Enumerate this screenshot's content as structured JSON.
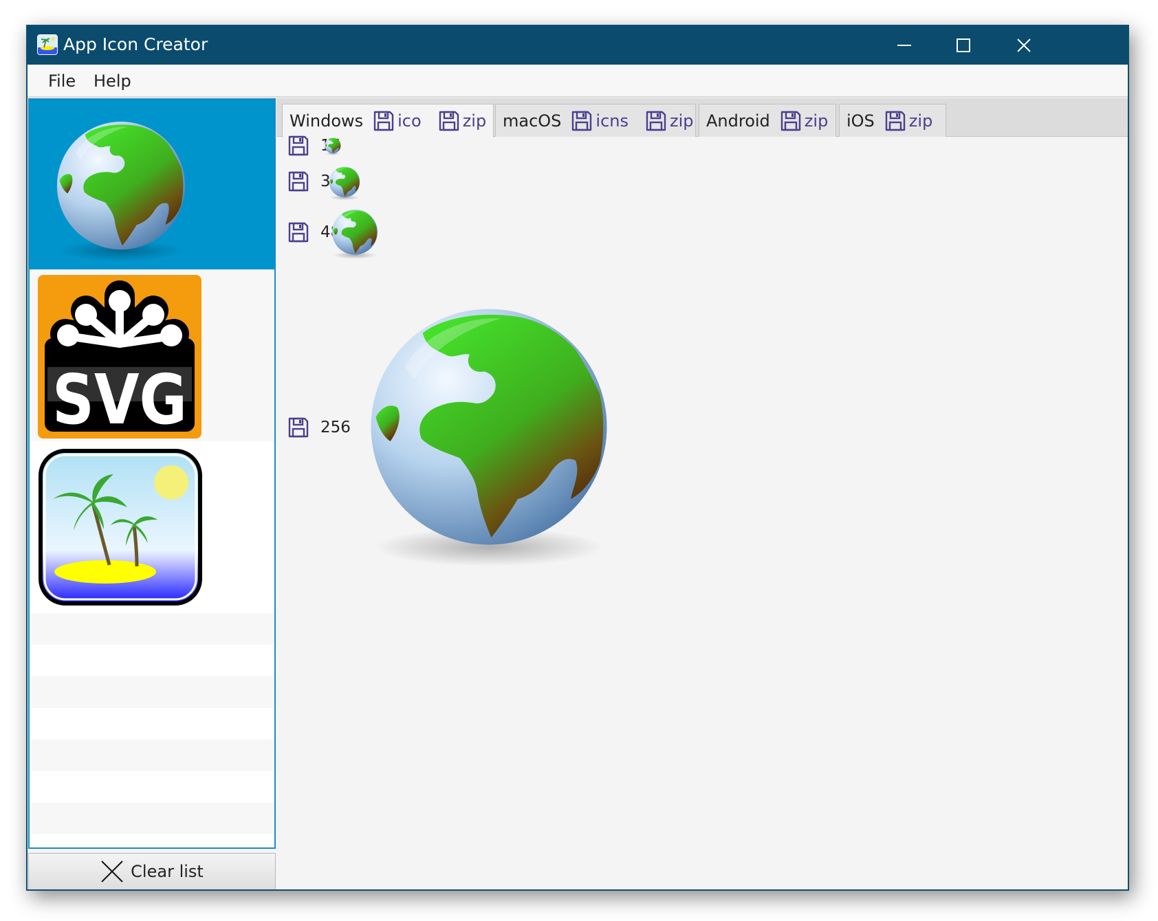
{
  "window": {
    "title": "App Icon Creator"
  },
  "menu": [
    "File",
    "Help"
  ],
  "sidebar": {
    "items": [
      {
        "name": "globe",
        "selected": true
      },
      {
        "name": "svg-logo",
        "selected": false,
        "logo_text": "SVG"
      },
      {
        "name": "palm-island",
        "selected": false
      }
    ],
    "clear_label": "Clear list"
  },
  "tabs": [
    {
      "label": "Windows",
      "buttons": [
        "ico",
        "zip"
      ],
      "active": true
    },
    {
      "label": "macOS",
      "buttons": [
        "icns",
        "zip"
      ],
      "active": false
    },
    {
      "label": "Android",
      "buttons": [
        "zip"
      ],
      "active": false
    },
    {
      "label": "iOS",
      "buttons": [
        "zip"
      ],
      "active": false
    }
  ],
  "sizes": [
    "16",
    "32",
    "48",
    "256"
  ],
  "colors": {
    "titlebar": "#0a4b6e",
    "selection": "#0094cc",
    "accent_text": "#4a3f8e",
    "svg_orange": "#f49b0e"
  },
  "icons": [
    "save-icon",
    "close-icon",
    "minimize-icon",
    "maximize-icon"
  ]
}
